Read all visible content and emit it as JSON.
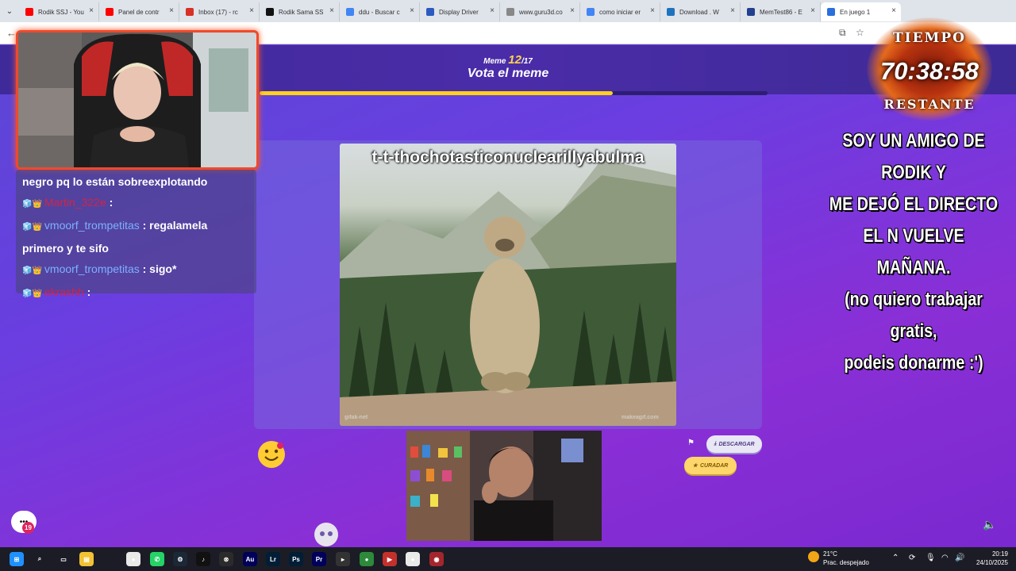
{
  "browser": {
    "tabs": [
      {
        "label": "Rodik SSJ - You",
        "color": "#ff0000"
      },
      {
        "label": "Panel de contr",
        "color": "#ff0000"
      },
      {
        "label": "Inbox (17) - rc",
        "color": "#d93025"
      },
      {
        "label": "Rodik Sama SS",
        "color": "#111111"
      },
      {
        "label": "ddu - Buscar c",
        "color": "#4285f4"
      },
      {
        "label": "Display Driver",
        "color": "#2c5bbf"
      },
      {
        "label": "www.guru3d.co",
        "color": "#888888"
      },
      {
        "label": "como iniciar er",
        "color": "#4285f4"
      },
      {
        "label": "Download . W",
        "color": "#1e73be"
      },
      {
        "label": "MemTest86 - E",
        "color": "#23408e"
      },
      {
        "label": "En juego 1",
        "color": "#2a6fdb"
      }
    ]
  },
  "game": {
    "meme_prefix": "Meme",
    "meme_current": "12",
    "meme_total": "/17",
    "vote_title": "Vota el meme",
    "progress_fraction": 0.695,
    "meme_caption": "t-t-thochotasticonuclearillyabulma",
    "watermark_left": "gifak-net",
    "watermark_right": "makeagif.com",
    "download_label": "DESCARGAR",
    "curate_label": "CURADAR",
    "notification_count": "19"
  },
  "stream": {
    "chat": [
      {
        "user": "",
        "text": "negro pq lo están sobreexplotando",
        "user_color": "red"
      },
      {
        "user": "Martin_322e",
        "text": ":",
        "user_color": "red"
      },
      {
        "user": "vmoorf_trompetitas",
        "text": ": regalamela primero y te sifo",
        "user_color": "blue"
      },
      {
        "user": "vmoorf_trompetitas",
        "text": ": sigo*",
        "user_color": "blue"
      },
      {
        "user": "ekrashh",
        "text": ":",
        "user_color": "red"
      }
    ],
    "timer_top": "TIEMPO",
    "timer_value": "70:38:58",
    "timer_bottom": "RESTANTE",
    "notice_lines": [
      "SOY UN AMIGO DE RODIK Y",
      "ME DEJÓ EL DIRECTO",
      "EL N VUELVE MAÑANA.",
      "(no quiero trabajar gratis,",
      "podeis donarme :')"
    ]
  },
  "taskbar": {
    "weather_temp": "21°C",
    "weather_desc": "Prac. despejado",
    "time": "20:19",
    "date": "24/10/2025",
    "apps": [
      "windows-start",
      "search",
      "task-view",
      "file-explorer",
      "chrome",
      "whatsapp",
      "steam",
      "tiktok",
      "xbox",
      "after-effects",
      "lightroom",
      "photoshop",
      "premiere",
      "terminal",
      "chrome-alt",
      "app-red",
      "chrome-beta",
      "obs"
    ]
  }
}
